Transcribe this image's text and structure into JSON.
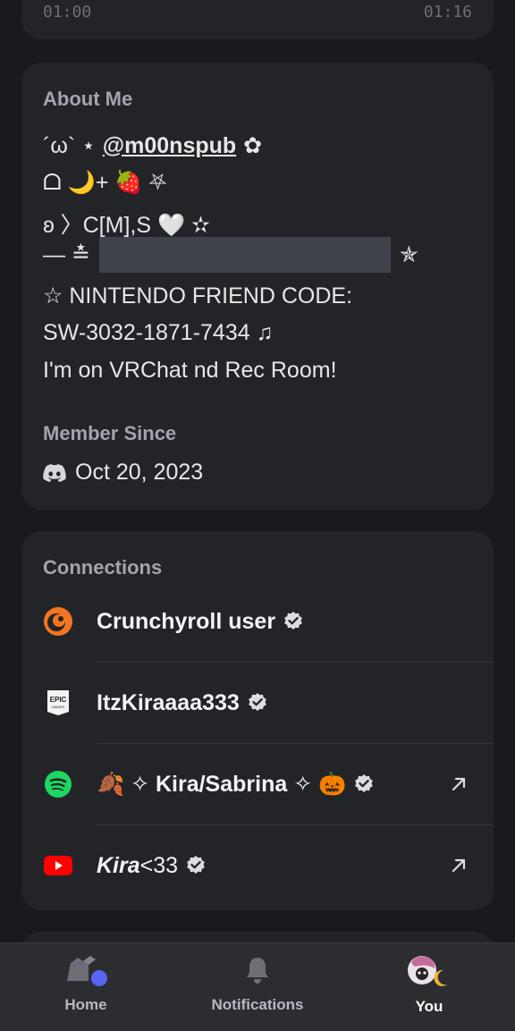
{
  "top_card": {
    "time_start": "01:00",
    "time_end": "01:16"
  },
  "about": {
    "title": "About Me",
    "line1_prefix": "´ω` ⋆",
    "mention": "@m00nspub",
    "line1_suffix": "✿",
    "line2": "ᗝ 🌙+ 🍓 ⛧",
    "line3": "ʚ 〉C[M],S 🤍 ✫",
    "line4_prefix": "— ≛",
    "line4_suffix": "✯",
    "line5": "☆ NINTENDO FRIEND CODE:",
    "line6": "SW-3032-1871-7434 ♫",
    "line7": "I'm on VRChat nd Rec Room!",
    "member_since_title": "Member Since",
    "member_since_date": "Oct 20, 2023"
  },
  "connections": {
    "title": "Connections",
    "items": [
      {
        "name": "Crunchyroll user",
        "icon": "crunchyroll-icon",
        "external": false
      },
      {
        "name": "ItzKiraaaa333",
        "icon": "epic-games-icon",
        "external": false
      },
      {
        "name": "🍂 ✧ Kira/Sabrina ✧ 🎃",
        "icon": "spotify-icon",
        "external": true
      },
      {
        "name_bold": "Kira",
        "name_rest": " <33",
        "icon": "youtube-icon",
        "external": true
      }
    ]
  },
  "nav": {
    "home": "Home",
    "notifications": "Notifications",
    "you": "You"
  },
  "colors": {
    "background": "#1a1a1e",
    "card": "#232428",
    "crunchyroll": "#f47521",
    "spotify": "#1ed760",
    "youtube": "#ff0000",
    "home_badge": "#5865f2"
  }
}
